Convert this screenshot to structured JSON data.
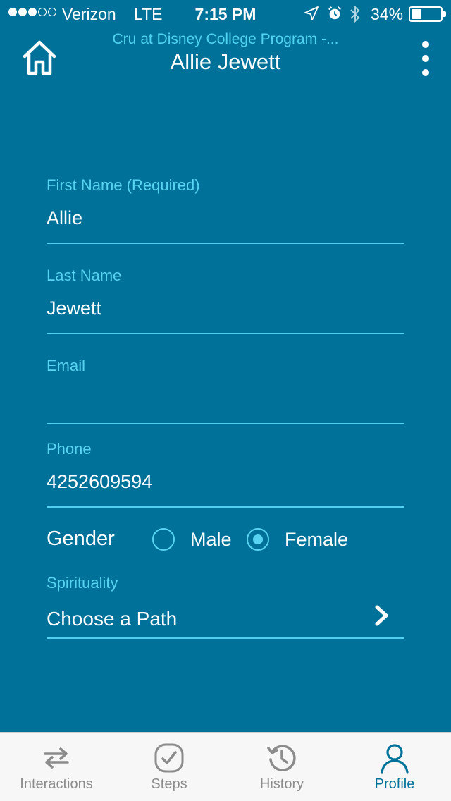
{
  "status_bar": {
    "carrier": "Verizon",
    "network": "LTE",
    "time": "7:15 PM",
    "battery_percent": "34%",
    "battery_level": 0.34,
    "signal_bars_filled": 3,
    "signal_bars_total": 5,
    "icons": [
      "location-arrow-icon",
      "alarm-clock-icon",
      "bluetooth-icon",
      "battery-icon"
    ]
  },
  "header": {
    "subtitle": "Cru at Disney College Program -...",
    "title": "Allie Jewett",
    "home_icon": "home-icon",
    "menu_icon": "more-vertical-icon"
  },
  "form": {
    "first_name": {
      "label": "First Name (Required)",
      "value": "Allie"
    },
    "last_name": {
      "label": "Last Name",
      "value": "Jewett"
    },
    "email": {
      "label": "Email",
      "value": ""
    },
    "phone": {
      "label": "Phone",
      "value": "4252609594"
    },
    "gender": {
      "label": "Gender",
      "options": [
        "Male",
        "Female"
      ],
      "selected": "Female"
    },
    "spirituality": {
      "label": "Spirituality",
      "value": "Choose a Path",
      "icon": "chevron-right-icon"
    }
  },
  "tab_bar": {
    "tabs": [
      {
        "label": "Interactions",
        "icon": "swap-arrows-icon",
        "active": false
      },
      {
        "label": "Steps",
        "icon": "check-circle-icon",
        "active": false
      },
      {
        "label": "History",
        "icon": "history-clock-icon",
        "active": false
      },
      {
        "label": "Profile",
        "icon": "person-icon",
        "active": true
      }
    ]
  },
  "colors": {
    "background": "#00729a",
    "accent": "#58d4f2",
    "tab_bar": "#f7f7f7",
    "tab_inactive": "#8c8c8c"
  }
}
